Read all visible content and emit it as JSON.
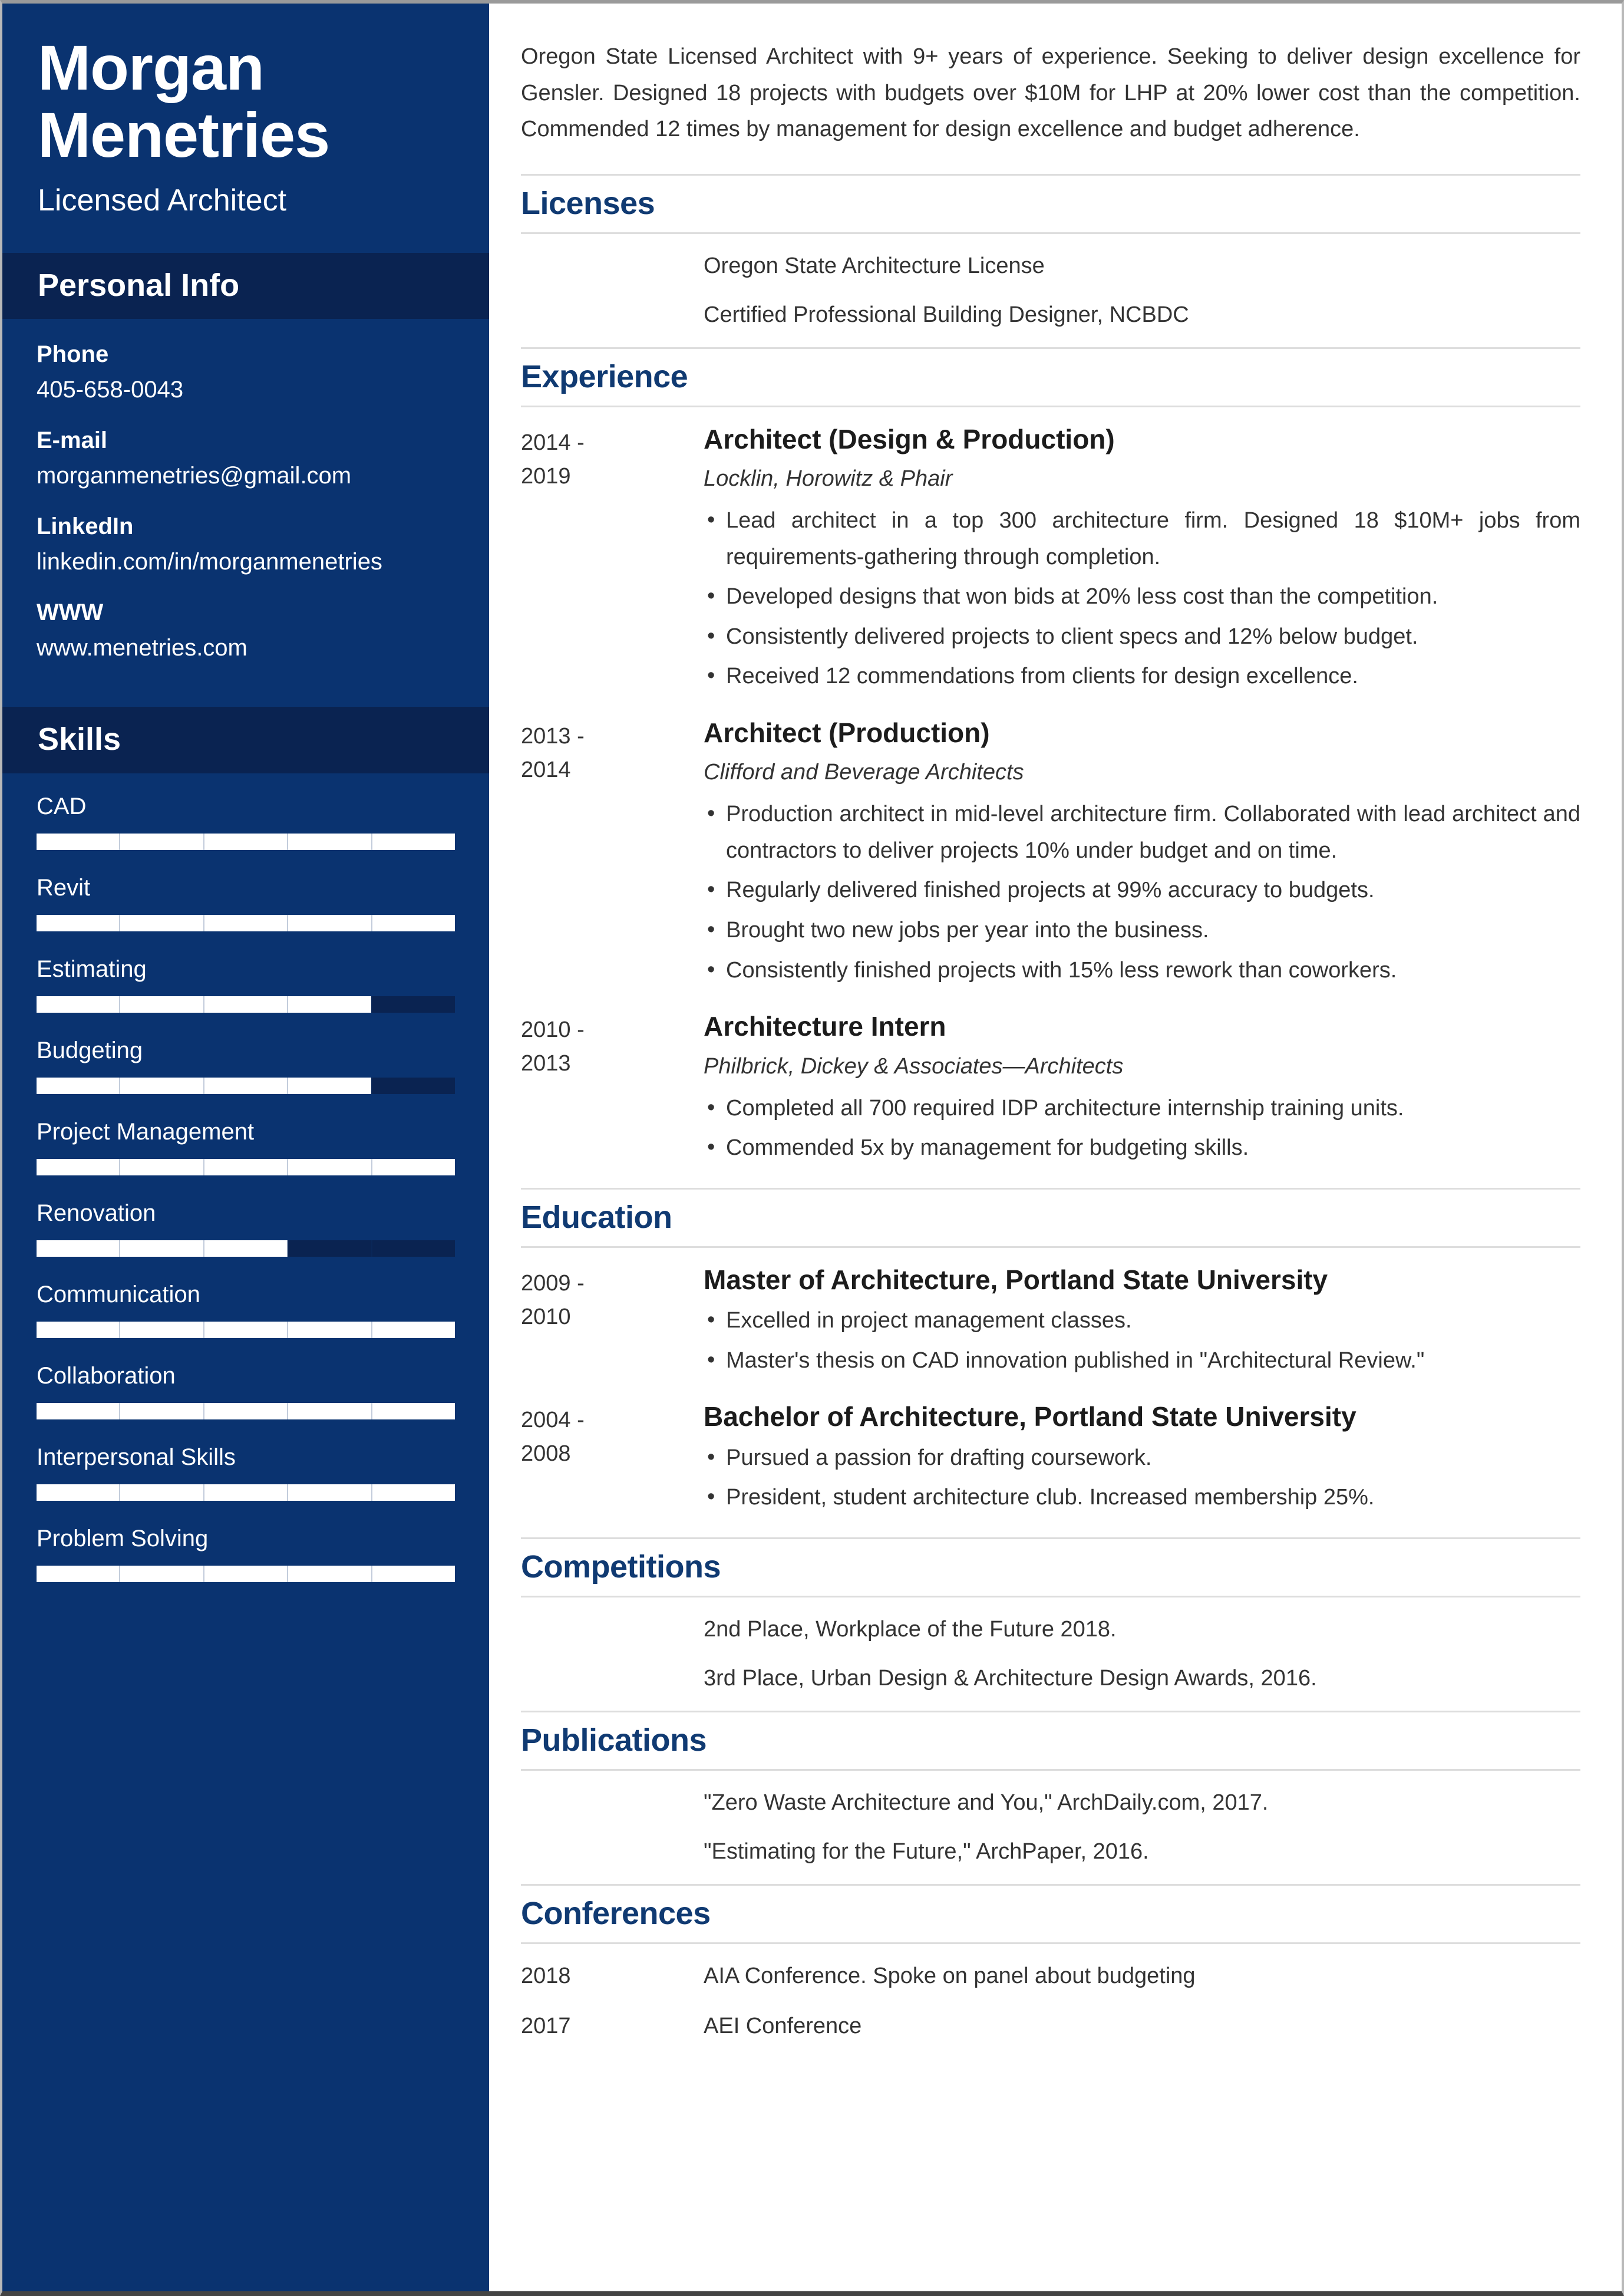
{
  "sidebar": {
    "name": "Morgan\nMenetries",
    "job_title": "Licensed Architect",
    "personal_info_heading": "Personal Info",
    "contacts": [
      {
        "label": "Phone",
        "value": "405-658-0043"
      },
      {
        "label": "E-mail",
        "value": "morganmenetries@gmail.com"
      },
      {
        "label": "LinkedIn",
        "value": "linkedin.com/in/morganmenetries"
      },
      {
        "label": "WWW",
        "value": "www.menetries.com"
      }
    ],
    "skills_heading": "Skills",
    "skills": [
      {
        "name": "CAD",
        "level": 100
      },
      {
        "name": "Revit",
        "level": 100
      },
      {
        "name": "Estimating",
        "level": 80
      },
      {
        "name": "Budgeting",
        "level": 80
      },
      {
        "name": "Project Management",
        "level": 100
      },
      {
        "name": "Renovation",
        "level": 60
      },
      {
        "name": "Communication",
        "level": 100
      },
      {
        "name": "Collaboration",
        "level": 100
      },
      {
        "name": "Interpersonal Skills",
        "level": 100
      },
      {
        "name": "Problem Solving",
        "level": 100
      }
    ],
    "colors": {
      "sidebar_blue": "#0a3370",
      "band_navy": "#0a2351",
      "bar_fill": "#ffffff"
    }
  },
  "main": {
    "summary": "Oregon State Licensed Architect with 9+ years of experience. Seeking to deliver design excellence for Gensler. Designed 18 projects with budgets over $10M for LHP at 20% lower cost than the competition. Commended 12 times by management for design excellence and budget adherence.",
    "licenses": {
      "heading": "Licenses",
      "items": [
        "Oregon State Architecture License",
        "Certified Professional Building Designer, NCBDC"
      ]
    },
    "experience": {
      "heading": "Experience",
      "entries": [
        {
          "dates": "2014 -\n2019",
          "title": "Architect (Design & Production)",
          "company": "Locklin, Horowitz & Phair",
          "bullets": [
            "Lead architect in a top 300 architecture firm. Designed 18 $10M+ jobs from requirements-gathering through completion.",
            "Developed designs that won bids at 20% less cost than the competition.",
            "Consistently delivered projects to client specs and 12% below budget.",
            "Received 12 commendations from clients for design excellence."
          ]
        },
        {
          "dates": "2013 -\n2014",
          "title": "Architect (Production)",
          "company": "Clifford and Beverage Architects",
          "bullets": [
            "Production architect in mid-level architecture firm. Collaborated with lead architect and contractors to deliver projects 10% under budget and on time.",
            "Regularly delivered finished projects at 99% accuracy to budgets.",
            "Brought two new jobs per year into the business.",
            "Consistently finished projects with 15% less rework than coworkers."
          ]
        },
        {
          "dates": "2010 -\n2013",
          "title": "Architecture Intern",
          "company": "Philbrick, Dickey & Associates—Architects",
          "bullets": [
            "Completed all 700 required IDP architecture internship training units.",
            "Commended 5x by management for budgeting skills."
          ]
        }
      ]
    },
    "education": {
      "heading": "Education",
      "entries": [
        {
          "dates": "2009 -\n2010",
          "title": "Master of Architecture, Portland State University",
          "bullets": [
            "Excelled in project management classes.",
            "Master's thesis on CAD innovation published in \"Architectural Review.\""
          ]
        },
        {
          "dates": "2004 -\n2008",
          "title": "Bachelor of Architecture, Portland State University",
          "bullets": [
            "Pursued a passion for drafting coursework.",
            "President, student architecture club. Increased membership 25%."
          ]
        }
      ]
    },
    "competitions": {
      "heading": "Competitions",
      "items": [
        "2nd Place, Workplace of the Future 2018.",
        "3rd Place, Urban Design & Architecture Design Awards, 2016."
      ]
    },
    "publications": {
      "heading": "Publications",
      "items": [
        "\"Zero Waste Architecture and You,\" ArchDaily.com, 2017.",
        "\"Estimating for the Future,\" ArchPaper, 2016."
      ]
    },
    "conferences": {
      "heading": "Conferences",
      "entries": [
        {
          "year": "2018",
          "text": "AIA Conference. Spoke on panel about budgeting"
        },
        {
          "year": "2017",
          "text": "AEI Conference"
        }
      ]
    },
    "colors": {
      "heading_blue": "#103a72",
      "body_text": "#333333",
      "rule": "#dddddd"
    }
  }
}
